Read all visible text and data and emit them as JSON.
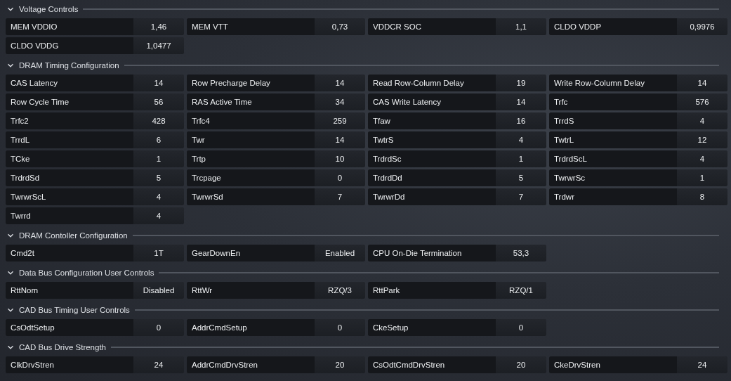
{
  "sections": [
    {
      "title": "Voltage Controls",
      "expanded": true,
      "items": [
        {
          "label": "MEM VDDIO",
          "value": "1,46"
        },
        {
          "label": "MEM VTT",
          "value": "0,73"
        },
        {
          "label": "VDDCR SOC",
          "value": "1,1"
        },
        {
          "label": "CLDO VDDP",
          "value": "0,9976"
        },
        {
          "label": "CLDO VDDG",
          "value": "1,0477"
        }
      ]
    },
    {
      "title": "DRAM Timing Configuration",
      "expanded": true,
      "items": [
        {
          "label": "CAS Latency",
          "value": "14"
        },
        {
          "label": "Row Precharge Delay",
          "value": "14"
        },
        {
          "label": "Read Row-Column Delay",
          "value": "19"
        },
        {
          "label": "Write Row-Column Delay",
          "value": "14"
        },
        {
          "label": "Row Cycle Time",
          "value": "56"
        },
        {
          "label": "RAS Active Time",
          "value": "34"
        },
        {
          "label": "CAS Write Latency",
          "value": "14"
        },
        {
          "label": "Trfc",
          "value": "576"
        },
        {
          "label": "Trfc2",
          "value": "428"
        },
        {
          "label": "Trfc4",
          "value": "259"
        },
        {
          "label": "Tfaw",
          "value": "16"
        },
        {
          "label": "TrrdS",
          "value": "4"
        },
        {
          "label": "TrrdL",
          "value": "6"
        },
        {
          "label": "Twr",
          "value": "14"
        },
        {
          "label": "TwtrS",
          "value": "4"
        },
        {
          "label": "TwtrL",
          "value": "12"
        },
        {
          "label": "TCke",
          "value": "1"
        },
        {
          "label": "Trtp",
          "value": "10"
        },
        {
          "label": "TrdrdSc",
          "value": "1"
        },
        {
          "label": "TrdrdScL",
          "value": "4"
        },
        {
          "label": "TrdrdSd",
          "value": "5"
        },
        {
          "label": "Trcpage",
          "value": "0"
        },
        {
          "label": "TrdrdDd",
          "value": "5"
        },
        {
          "label": "TwrwrSc",
          "value": "1"
        },
        {
          "label": "TwrwrScL",
          "value": "4"
        },
        {
          "label": "TwrwrSd",
          "value": "7"
        },
        {
          "label": "TwrwrDd",
          "value": "7"
        },
        {
          "label": "Trdwr",
          "value": "8"
        },
        {
          "label": "Twrrd",
          "value": "4"
        }
      ]
    },
    {
      "title": "DRAM Contoller Configuration",
      "expanded": true,
      "items": [
        {
          "label": "Cmd2t",
          "value": "1T"
        },
        {
          "label": "GearDownEn",
          "value": "Enabled"
        },
        {
          "label": "CPU On-Die Termination",
          "value": "53,3"
        }
      ]
    },
    {
      "title": "Data Bus Configuration User Controls",
      "expanded": true,
      "items": [
        {
          "label": "RttNom",
          "value": "Disabled"
        },
        {
          "label": "RttWr",
          "value": "RZQ/3"
        },
        {
          "label": "RttPark",
          "value": "RZQ/1"
        }
      ]
    },
    {
      "title": "CAD Bus Timing User Controls",
      "expanded": true,
      "items": [
        {
          "label": "CsOdtSetup",
          "value": "0"
        },
        {
          "label": "AddrCmdSetup",
          "value": "0"
        },
        {
          "label": "CkeSetup",
          "value": "0"
        }
      ]
    },
    {
      "title": "CAD Bus Drive Strength",
      "expanded": true,
      "items": [
        {
          "label": "ClkDrvStren",
          "value": "24"
        },
        {
          "label": "AddrCmdDrvStren",
          "value": "20"
        },
        {
          "label": "CsOdtCmdDrvStren",
          "value": "20"
        },
        {
          "label": "CkeDrvStren",
          "value": "24"
        }
      ]
    }
  ]
}
